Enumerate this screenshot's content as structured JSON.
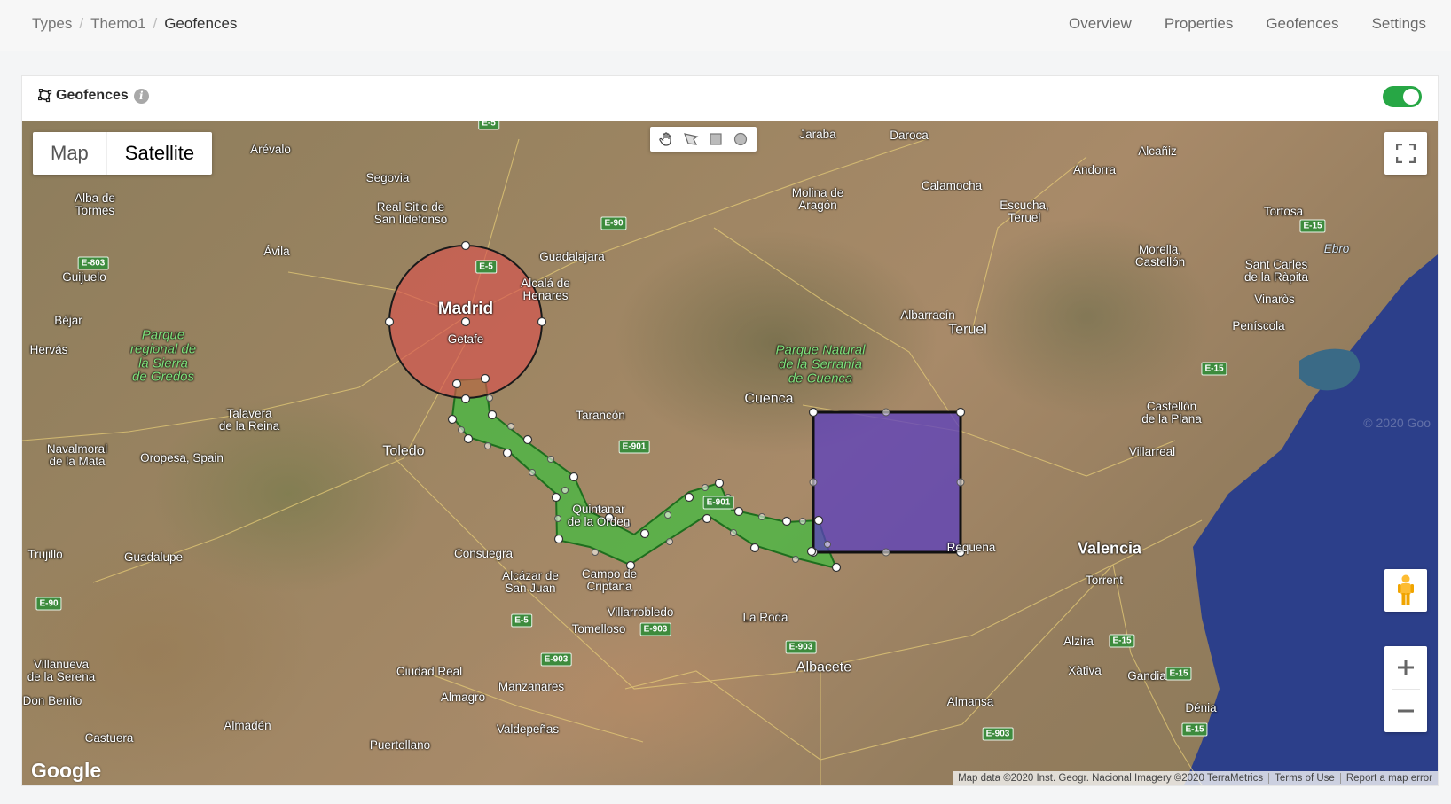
{
  "breadcrumb": {
    "items": [
      "Types",
      "Themo1",
      "Geofences"
    ]
  },
  "nav": {
    "overview": "Overview",
    "properties": "Properties",
    "geofences": "Geofences",
    "settings": "Settings"
  },
  "panel": {
    "title": "Geofences",
    "enabled": true
  },
  "map": {
    "map_type_options": [
      "Map",
      "Satellite"
    ],
    "selected_map_type": "Satellite",
    "drawing_tools": [
      "hand-icon",
      "polygon-icon",
      "rectangle-icon",
      "circle-icon"
    ],
    "google_logo": "Google",
    "attribution": {
      "data": "Map data ©2020 Inst. Geogr. Nacional Imagery ©2020 TerraMetrics",
      "terms": "Terms of Use",
      "report": "Report a map error"
    },
    "watermark": "© 2020 Goo",
    "geofence_colors": {
      "circle": "#d9534f",
      "polyline": "#3fbf3f",
      "rectangle": "#5b3fbf"
    },
    "place_labels": [
      {
        "t": "Arévalo"
      },
      {
        "t": "Segovia"
      },
      {
        "t": "Alba de\nTormes"
      },
      {
        "t": "Real Sitio de\nSan Ildefonso"
      },
      {
        "t": "Ávila"
      },
      {
        "t": "Guadalajara"
      },
      {
        "t": "Guijuelo"
      },
      {
        "t": "Madrid"
      },
      {
        "t": "Getafe"
      },
      {
        "t": "Alcalá de\nHenares"
      },
      {
        "t": "Béjar"
      },
      {
        "t": "Hervás"
      },
      {
        "t": "Talavera\nde la Reina"
      },
      {
        "t": "Toledo"
      },
      {
        "t": "Navalmoral\nde la Mata"
      },
      {
        "t": "Oropesa, Spain"
      },
      {
        "t": "Tarancón"
      },
      {
        "t": "Trujillo"
      },
      {
        "t": "Guadalupe"
      },
      {
        "t": "Consuegra"
      },
      {
        "t": "Alcázar de\nSan Juan"
      },
      {
        "t": "Campo de\nCriptana"
      },
      {
        "t": "Quintanar\nde la Orden"
      },
      {
        "t": "Villarrobledo"
      },
      {
        "t": "Tomelloso"
      },
      {
        "t": "La Roda"
      },
      {
        "t": "Ciudad Real"
      },
      {
        "t": "Almagro"
      },
      {
        "t": "Manzanares"
      },
      {
        "t": "Villanueva\nde la Serena"
      },
      {
        "t": "Don Benito"
      },
      {
        "t": "Castuera"
      },
      {
        "t": "Almadén"
      },
      {
        "t": "Puertollano"
      },
      {
        "t": "Valdepeñas"
      },
      {
        "t": "Albacete"
      },
      {
        "t": "Almansa"
      },
      {
        "t": "Cuenca"
      },
      {
        "t": "Jaraba"
      },
      {
        "t": "Daroca"
      },
      {
        "t": "Molina de\nAragón"
      },
      {
        "t": "Calamocha"
      },
      {
        "t": "Alcañiz"
      },
      {
        "t": "Andorra"
      },
      {
        "t": "Escucha,\nTeruel"
      },
      {
        "t": "Tortosa"
      },
      {
        "t": "Morella,\nCastellón"
      },
      {
        "t": "Sant Carles\nde la Ràpita"
      },
      {
        "t": "Vinaròs"
      },
      {
        "t": "Peníscola"
      },
      {
        "t": "Albarracín"
      },
      {
        "t": "Teruel"
      },
      {
        "t": "Castellón\nde la Plana"
      },
      {
        "t": "Villarreal"
      },
      {
        "t": "Valencia"
      },
      {
        "t": "Torrent"
      },
      {
        "t": "Requena"
      },
      {
        "t": "Alzira"
      },
      {
        "t": "Xàtiva"
      },
      {
        "t": "Gandia"
      },
      {
        "t": "Dénia"
      },
      {
        "t": "Ebro"
      }
    ],
    "park_labels": [
      {
        "t": "Parque\nregional de\nla Sierra\nde Gredos"
      },
      {
        "t": "Parque Natural\nde la Serranía\nde Cuenca"
      }
    ],
    "road_labels": [
      "E-5",
      "E-90",
      "E-803",
      "E-5",
      "E-901",
      "E-901",
      "E-903",
      "E-903",
      "E-903",
      "E-5",
      "E-90",
      "E-15",
      "E-15",
      "E-15",
      "E-15",
      "E-903",
      "E-15"
    ]
  }
}
